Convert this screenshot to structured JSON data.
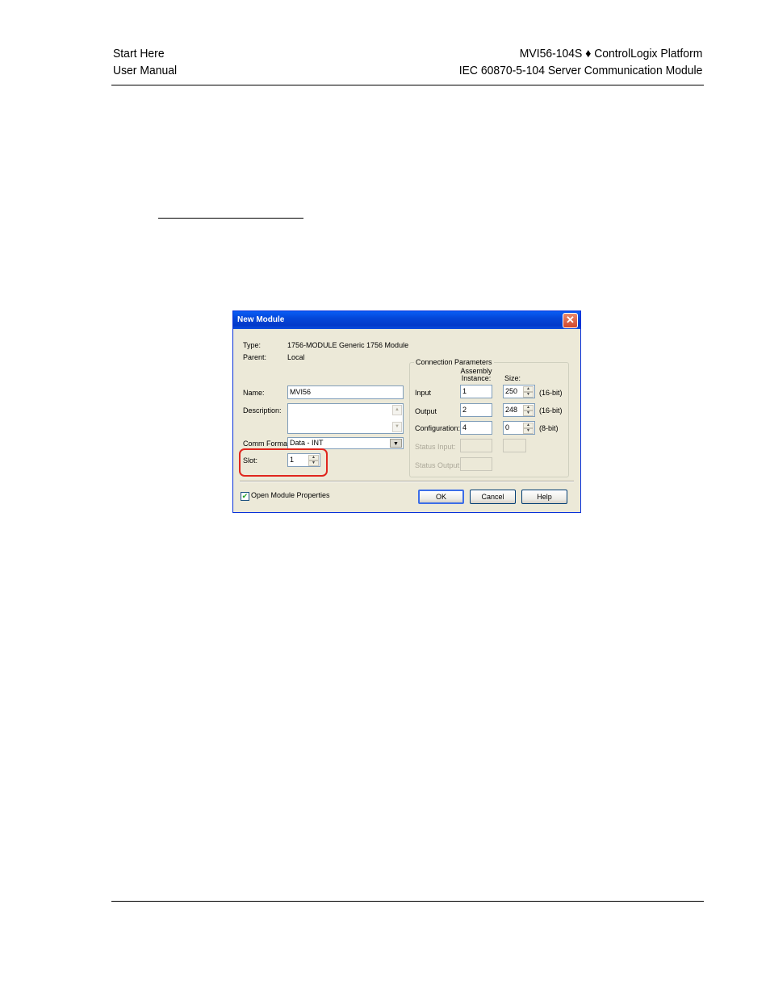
{
  "header": {
    "left": [
      "Start Here",
      "User Manual"
    ],
    "right": [
      "MVI56-104S ♦ ControlLogix Platform",
      "IEC 60870-5-104 Server Communication Module"
    ]
  },
  "dialog": {
    "title": "New Module",
    "close_glyph": "✕",
    "type_label": "Type:",
    "type_value": "1756-MODULE Generic 1756 Module",
    "parent_label": "Parent:",
    "parent_value": "Local",
    "name_label": "Name:",
    "name_value": "MVI56",
    "description_label": "Description:",
    "description_value": "",
    "comm_format_label": "Comm Format:",
    "comm_format_value": "Data - INT",
    "slot_label": "Slot:",
    "slot_value": "1",
    "connection": {
      "title": "Connection Parameters",
      "assembly_header": "Assembly Instance:",
      "size_header": "Size:",
      "rows": [
        {
          "label": "Input",
          "instance": "1",
          "size": "250",
          "unit": "(16-bit)"
        },
        {
          "label": "Output",
          "instance": "2",
          "size": "248",
          "unit": "(16-bit)"
        },
        {
          "label": "Configuration:",
          "instance": "4",
          "size": "0",
          "unit": "(8-bit)"
        },
        {
          "label": "Status Input:",
          "instance": "",
          "size": ""
        },
        {
          "label": "Status Output:",
          "instance": ""
        }
      ]
    },
    "open_properties_label": "Open Module Properties",
    "open_properties_checked": "✔",
    "buttons": {
      "ok": "OK",
      "cancel": "Cancel",
      "help": "Help"
    }
  }
}
